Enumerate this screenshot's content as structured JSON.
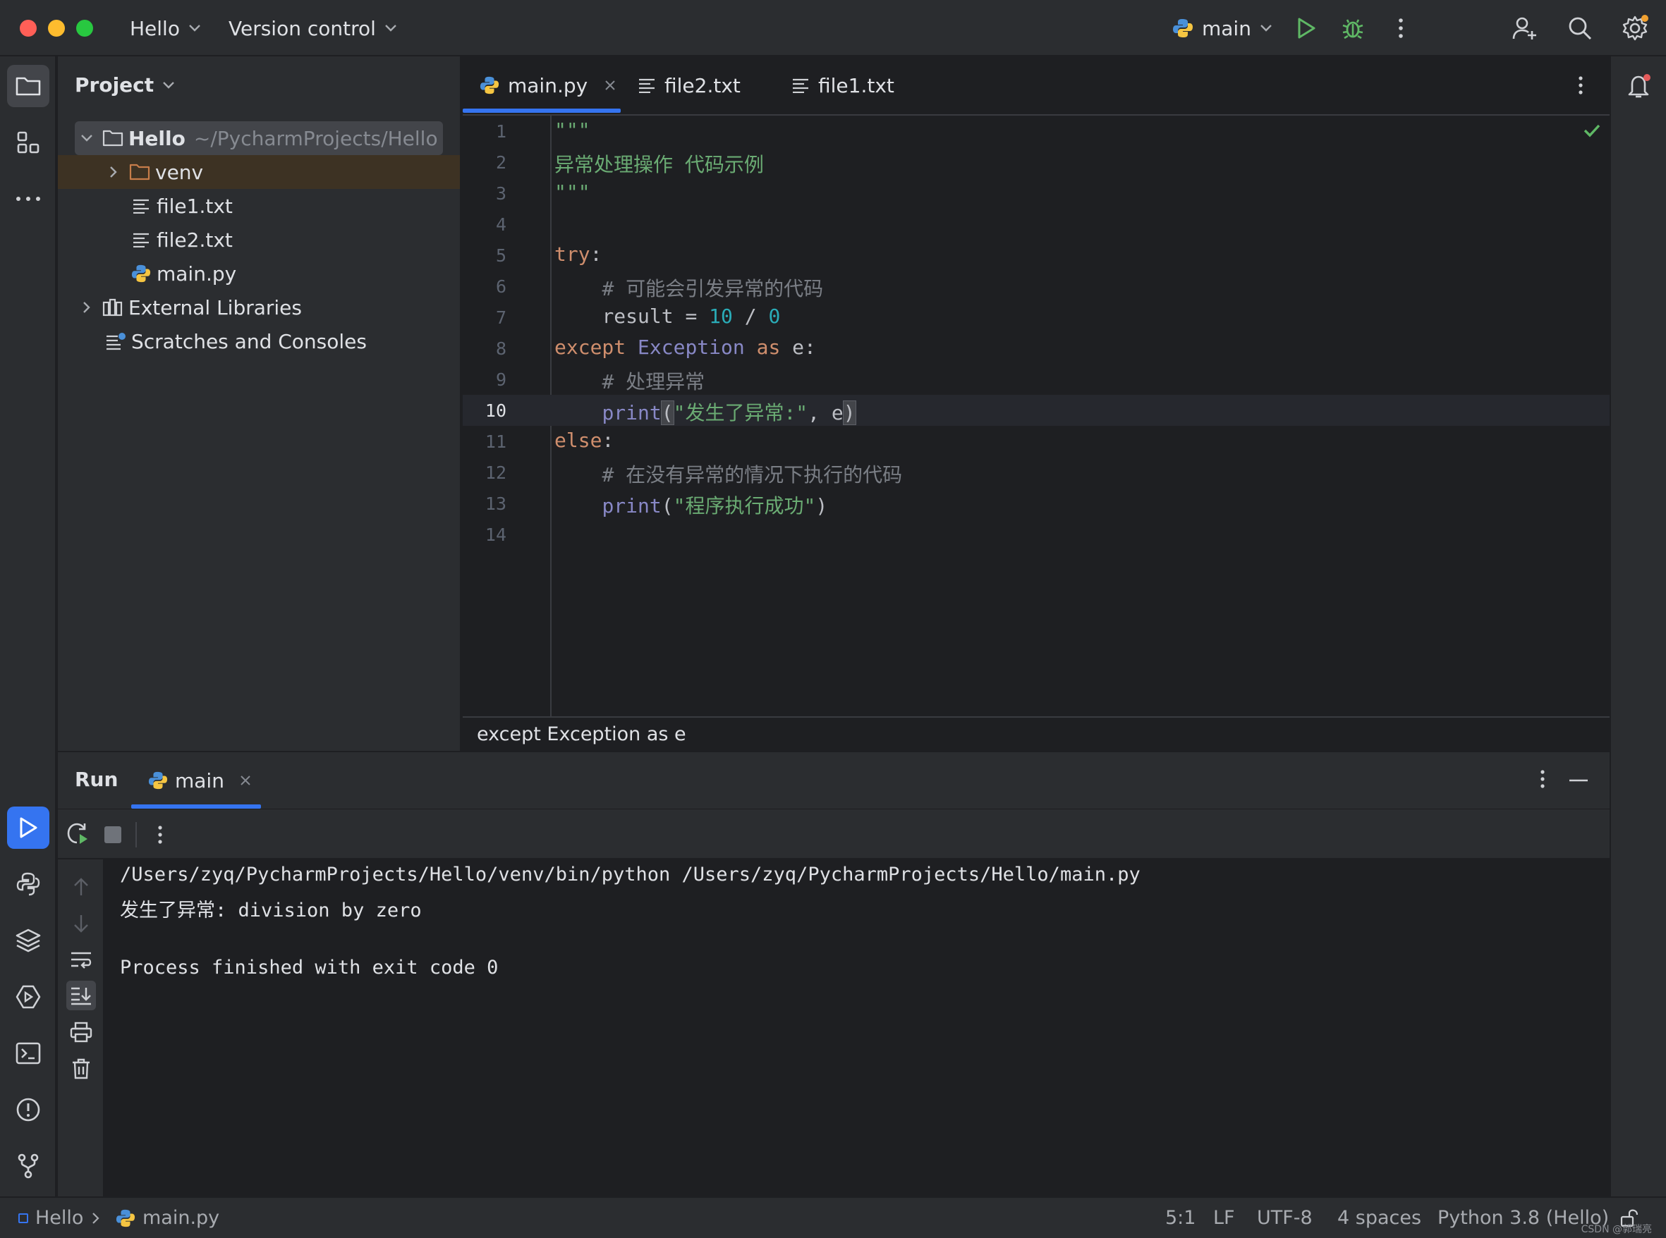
{
  "titlebar": {
    "project_name": "Hello",
    "vcs_label": "Version control",
    "run_config": "main"
  },
  "project_panel": {
    "title": "Project",
    "tree": [
      {
        "label": "Hello",
        "path": "~/PycharmProjects/Hello"
      },
      {
        "label": "venv"
      },
      {
        "label": "file1.txt"
      },
      {
        "label": "file2.txt"
      },
      {
        "label": "main.py"
      },
      {
        "label": "External Libraries"
      },
      {
        "label": "Scratches and Consoles"
      }
    ]
  },
  "editor": {
    "tabs": [
      {
        "label": "main.py"
      },
      {
        "label": "file2.txt"
      },
      {
        "label": "file1.txt"
      }
    ],
    "line_numbers": [
      "1",
      "2",
      "3",
      "4",
      "5",
      "6",
      "7",
      "8",
      "9",
      "10",
      "11",
      "12",
      "13",
      "14"
    ],
    "current_line": "10",
    "code": {
      "l1": "\"\"\"",
      "l2": "异常处理操作 代码示例",
      "l3": "\"\"\"",
      "l5_kw": "try",
      "l6_cm": "# 可能会引发异常的代码",
      "l7_var": "result = ",
      "l7_num1": "10",
      "l7_op": " / ",
      "l7_num2": "0",
      "l8_kw1": "except",
      "l8_cls": "Exception",
      "l8_kw2": "as",
      "l8_var": " e:",
      "l9_cm": "# 处理异常",
      "l10_fn": "print",
      "l10_str": "\"发生了异常:\"",
      "l10_rest": ", e",
      "l11_kw": "else",
      "l12_cm": "# 在没有异常的情况下执行的代码",
      "l13_fn": "print",
      "l13_str": "\"程序执行成功\""
    },
    "breadcrumb": "except Exception as e"
  },
  "run_panel": {
    "title": "Run",
    "tab_label": "main",
    "console_lines": [
      "/Users/zyq/PycharmProjects/Hello/venv/bin/python /Users/zyq/PycharmProjects/Hello/main.py",
      "发生了异常: division by zero",
      "",
      "Process finished with exit code 0"
    ]
  },
  "statusbar": {
    "crumb_project": "Hello",
    "crumb_file": "main.py",
    "position": "5:1",
    "line_sep": "LF",
    "encoding": "UTF-8",
    "indent": "4 spaces",
    "interpreter": "Python 3.8 (Hello)",
    "watermark": "CSDN @郭瑞亮"
  },
  "colors": {
    "accent": "#3574f0",
    "run_green": "#5fb865",
    "close_red": "#ff5f57",
    "minimize_yellow": "#febc2e",
    "maximize_green": "#28c840"
  }
}
